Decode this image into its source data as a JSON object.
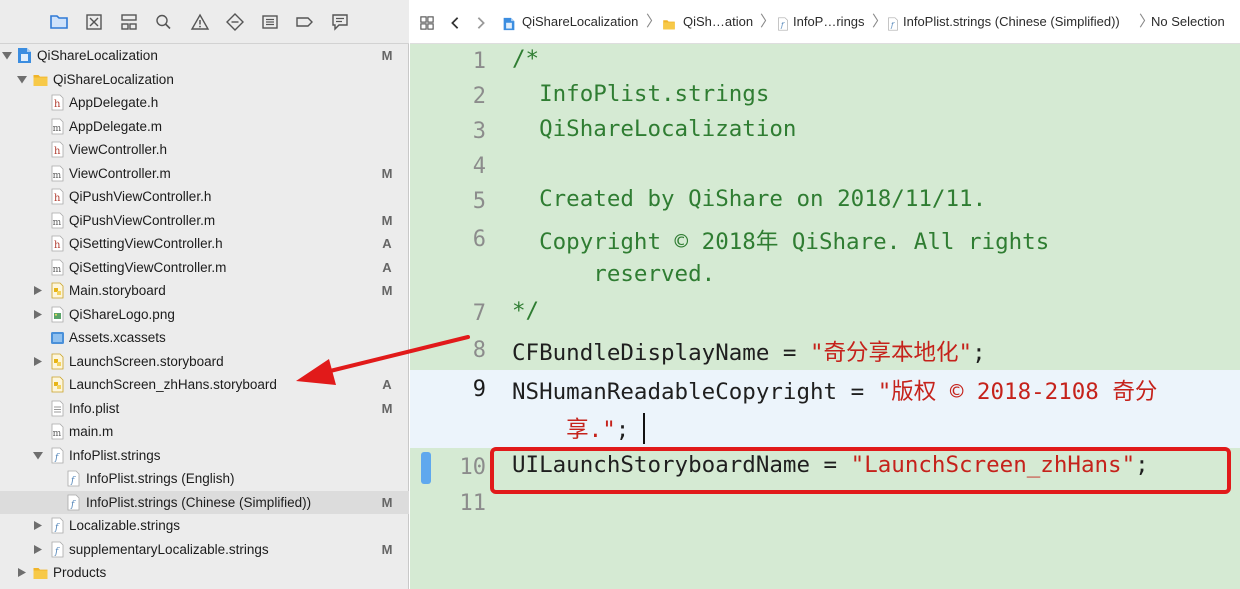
{
  "navigator": {
    "toolbar_icons": [
      "folder-icon",
      "source-control-icon",
      "hierarchy-icon",
      "find-icon",
      "issue-icon",
      "test-icon",
      "debug-icon",
      "breakpoint-icon",
      "report-icon"
    ],
    "tree": [
      {
        "label": "QiShareLocalization",
        "status": "M",
        "icon": "project-icon",
        "indent": 0,
        "disclosure": "open"
      },
      {
        "label": "QiShareLocalization",
        "status": "",
        "icon": "group-folder-icon",
        "indent": 1,
        "disclosure": "open"
      },
      {
        "label": "AppDelegate.h",
        "status": "",
        "icon": "header-file-icon",
        "indent": 2,
        "disclosure": ""
      },
      {
        "label": "AppDelegate.m",
        "status": "",
        "icon": "objc-file-icon",
        "indent": 2,
        "disclosure": ""
      },
      {
        "label": "ViewController.h",
        "status": "",
        "icon": "header-file-icon",
        "indent": 2,
        "disclosure": ""
      },
      {
        "label": "ViewController.m",
        "status": "M",
        "icon": "objc-file-icon",
        "indent": 2,
        "disclosure": ""
      },
      {
        "label": "QiPushViewController.h",
        "status": "",
        "icon": "header-file-icon",
        "indent": 2,
        "disclosure": ""
      },
      {
        "label": "QiPushViewController.m",
        "status": "M",
        "icon": "objc-file-icon",
        "indent": 2,
        "disclosure": ""
      },
      {
        "label": "QiSettingViewController.h",
        "status": "A",
        "icon": "header-file-icon",
        "indent": 2,
        "disclosure": ""
      },
      {
        "label": "QiSettingViewController.m",
        "status": "A",
        "icon": "objc-file-icon",
        "indent": 2,
        "disclosure": ""
      },
      {
        "label": "Main.storyboard",
        "status": "M",
        "icon": "storyboard-icon",
        "indent": 2,
        "disclosure": "closed"
      },
      {
        "label": "QiShareLogo.png",
        "status": "",
        "icon": "image-file-icon",
        "indent": 2,
        "disclosure": "closed"
      },
      {
        "label": "Assets.xcassets",
        "status": "",
        "icon": "asset-catalog-icon",
        "indent": 2,
        "disclosure": ""
      },
      {
        "label": "LaunchScreen.storyboard",
        "status": "",
        "icon": "storyboard-icon",
        "indent": 2,
        "disclosure": "closed"
      },
      {
        "label": "LaunchScreen_zhHans.storyboard",
        "status": "A",
        "icon": "storyboard-icon",
        "indent": 2,
        "disclosure": ""
      },
      {
        "label": "Info.plist",
        "status": "M",
        "icon": "plist-file-icon",
        "indent": 2,
        "disclosure": ""
      },
      {
        "label": "main.m",
        "status": "",
        "icon": "objc-file-icon",
        "indent": 2,
        "disclosure": ""
      },
      {
        "label": "InfoPlist.strings",
        "status": "",
        "icon": "strings-file-icon",
        "indent": 2,
        "disclosure": "open"
      },
      {
        "label": "InfoPlist.strings (English)",
        "status": "",
        "icon": "strings-file-icon",
        "indent": 3,
        "disclosure": ""
      },
      {
        "label": "InfoPlist.strings (Chinese (Simplified))",
        "status": "M",
        "icon": "strings-file-icon",
        "indent": 3,
        "disclosure": "",
        "selected": true
      },
      {
        "label": "Localizable.strings",
        "status": "",
        "icon": "strings-file-icon",
        "indent": 2,
        "disclosure": "closed"
      },
      {
        "label": "supplementaryLocalizable.strings",
        "status": "M",
        "icon": "strings-file-icon",
        "indent": 2,
        "disclosure": "closed"
      },
      {
        "label": "Products",
        "status": "",
        "icon": "group-folder-icon",
        "indent": 1,
        "disclosure": "closed"
      }
    ]
  },
  "jump_bar": {
    "crumbs": [
      {
        "label": "QiShareLocalization",
        "icon": "project-icon"
      },
      {
        "label": "QiSh…ation",
        "icon": "group-folder-icon"
      },
      {
        "label": "InfoP…rings",
        "icon": "strings-file-icon"
      },
      {
        "label": "InfoPlist.strings (Chinese (Simplified))",
        "icon": "strings-file-icon"
      },
      {
        "label": "No Selection",
        "icon": ""
      }
    ],
    "separator": "〉"
  },
  "editor": {
    "current_line": "9",
    "lines": [
      {
        "num": "1",
        "segments": [
          {
            "t": "/*",
            "k": "comment"
          }
        ]
      },
      {
        "num": "2",
        "segments": [
          {
            "t": "  InfoPlist.strings",
            "k": "comment"
          }
        ]
      },
      {
        "num": "3",
        "segments": [
          {
            "t": "  QiShareLocalization",
            "k": "comment"
          }
        ]
      },
      {
        "num": "4",
        "segments": [
          {
            "t": "",
            "k": "comment"
          }
        ]
      },
      {
        "num": "5",
        "segments": [
          {
            "t": "  Created by QiShare on 2018/11/11.",
            "k": "comment"
          }
        ]
      },
      {
        "num": "6",
        "segments": [
          {
            "t": "  Copyright © 2018年 QiShare. All rights",
            "k": "comment"
          }
        ]
      },
      {
        "num": "",
        "segments": [
          {
            "t": "      reserved.",
            "k": "comment"
          }
        ]
      },
      {
        "num": "7",
        "segments": [
          {
            "t": "*/",
            "k": "comment"
          }
        ]
      },
      {
        "num": "8",
        "segments": [
          {
            "t": "CFBundleDisplayName = ",
            "k": "key"
          },
          {
            "t": "\"奇分享本地化\"",
            "k": "str"
          },
          {
            "t": ";",
            "k": "key"
          }
        ]
      },
      {
        "num": "9",
        "segments": [
          {
            "t": "NSHumanReadableCopyright = ",
            "k": "key"
          },
          {
            "t": "\"版权 © 2018-2108 奇分",
            "k": "str"
          }
        ]
      },
      {
        "num": "",
        "segments": [
          {
            "t": "    享.\"",
            "k": "str"
          },
          {
            "t": ";",
            "k": "key"
          }
        ]
      },
      {
        "num": "10",
        "segments": [
          {
            "t": "UILaunchStoryboardName = ",
            "k": "key"
          },
          {
            "t": "\"LaunchScreen_zhHans\"",
            "k": "str"
          },
          {
            "t": ";",
            "k": "key"
          }
        ]
      },
      {
        "num": "11",
        "segments": []
      }
    ]
  },
  "colors": {
    "editor_background": "#d5ead3",
    "comment": "#2f7d32",
    "string": "#c5221b",
    "annotation_red": "#e11a1a"
  }
}
